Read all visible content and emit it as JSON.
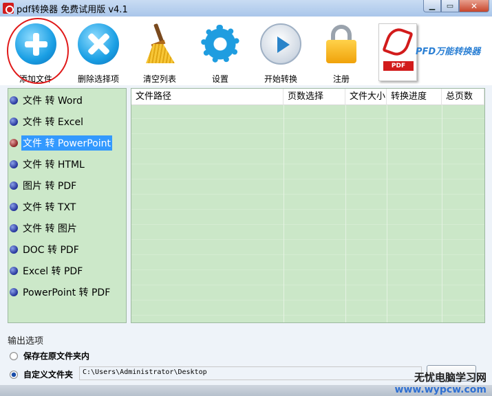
{
  "window": {
    "title": "pdf转换器 免费试用版 v4.1",
    "minimize_icon": "minimize-icon",
    "maximize_icon": "maximize-icon",
    "close_icon": "close-icon"
  },
  "toolbar": {
    "items": [
      {
        "label": "添加文件",
        "icon": "add-icon"
      },
      {
        "label": "删除选择项",
        "icon": "delete-icon"
      },
      {
        "label": "清空列表",
        "icon": "broom-icon"
      },
      {
        "label": "设置",
        "icon": "gear-icon"
      },
      {
        "label": "开始转换",
        "icon": "play-icon"
      },
      {
        "label": "注册",
        "icon": "lock-icon"
      }
    ],
    "logo_tag": "PDF",
    "brand": "PFD万能转换器"
  },
  "conversion_list": {
    "selected_index": 2,
    "items": [
      "文件 转 Word",
      "文件 转 Excel",
      "文件 转 PowerPoint",
      "文件 转 HTML",
      "图片 转 PDF",
      "文件 转 TXT",
      "文件 转 图片",
      "DOC 转 PDF",
      "Excel 转 PDF",
      "PowerPoint 转 PDF"
    ]
  },
  "file_table": {
    "columns": [
      "文件路径",
      "页数选择",
      "文件大小",
      "转换进度",
      "总页数"
    ],
    "rows": []
  },
  "output": {
    "section_title": "输出选项",
    "option_original": "保存在原文件夹内",
    "option_custom": "自定义文件夹",
    "selected": "custom",
    "path": "C:\\Users\\Administrator\\Desktop"
  },
  "watermark": {
    "line1": "无忧电脑学习网",
    "line2": "www.wypcw.com"
  }
}
